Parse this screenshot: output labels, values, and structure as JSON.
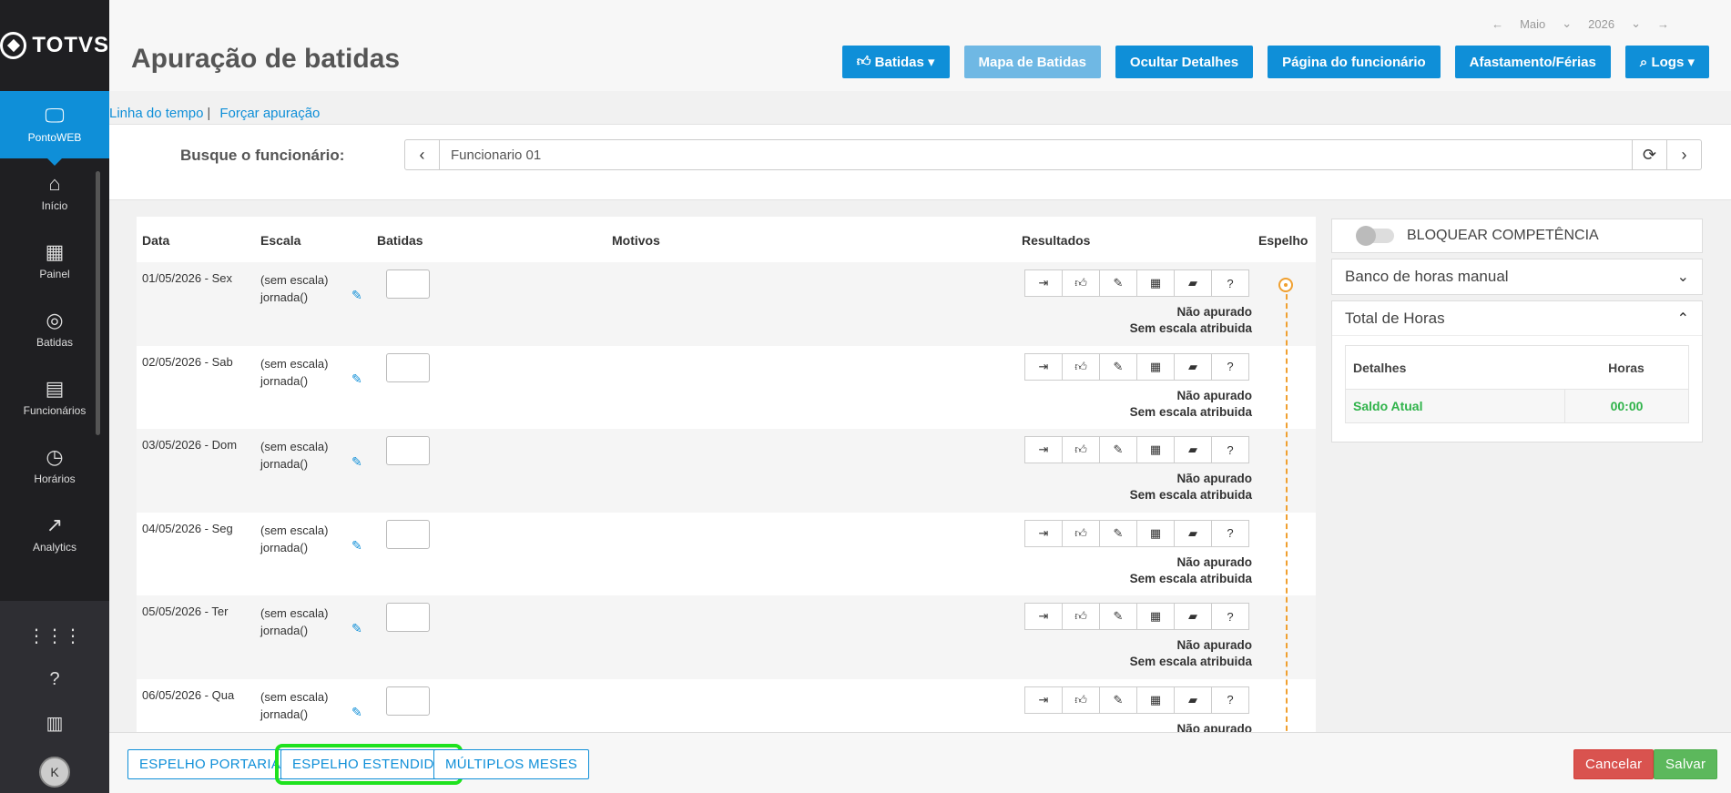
{
  "brand": "TOTVS",
  "nav": [
    {
      "label": "PontoWEB",
      "icon": "monitor-icon"
    },
    {
      "label": "Início",
      "icon": "home-icon"
    },
    {
      "label": "Painel",
      "icon": "dashboard-icon"
    },
    {
      "label": "Batidas",
      "icon": "fingerprint-icon"
    },
    {
      "label": "Funcionários",
      "icon": "badge-icon"
    },
    {
      "label": "Horários",
      "icon": "clock-icon"
    },
    {
      "label": "Analytics",
      "icon": "trend-icon"
    }
  ],
  "month": "Maio",
  "year": "2026",
  "title": "Apuração de batidas",
  "buttons": {
    "batidas": "Batidas",
    "mapa": "Mapa de Batidas",
    "ocultar": "Ocultar Detalhes",
    "pagina": "Página do funcionário",
    "afast": "Afastamento/Férias",
    "logs": "Logs"
  },
  "links": {
    "linha": "Linha do tempo",
    "sep": "|",
    "forcar": "Forçar apuração"
  },
  "search": {
    "label": "Busque o funcionário:",
    "value": "Funcionario 01"
  },
  "table": {
    "headers": {
      "data": "Data",
      "escala": "Escala",
      "batidas": "Batidas",
      "motivos": "Motivos",
      "resultados": "Resultados",
      "espelho": "Espelho"
    },
    "rows": [
      {
        "date": "01/05/2026 - Sex",
        "escala": "(sem escala)",
        "jornada": "jornada()",
        "r1": "Não apurado",
        "r2": "Sem escala atribuida"
      },
      {
        "date": "02/05/2026 - Sab",
        "escala": "(sem escala)",
        "jornada": "jornada()",
        "r1": "Não apurado",
        "r2": "Sem escala atribuida"
      },
      {
        "date": "03/05/2026 - Dom",
        "escala": "(sem escala)",
        "jornada": "jornada()",
        "r1": "Não apurado",
        "r2": "Sem escala atribuida"
      },
      {
        "date": "04/05/2026 - Seg",
        "escala": "(sem escala)",
        "jornada": "jornada()",
        "r1": "Não apurado",
        "r2": "Sem escala atribuida"
      },
      {
        "date": "05/05/2026 - Ter",
        "escala": "(sem escala)",
        "jornada": "jornada()",
        "r1": "Não apurado",
        "r2": "Sem escala atribuida"
      },
      {
        "date": "06/05/2026 - Qua",
        "escala": "(sem escala)",
        "jornada": "jornada()",
        "r1": "Não apurado",
        "r2": ""
      }
    ]
  },
  "right": {
    "bloquear": "BLOQUEAR COMPETÊNCIA",
    "banco": "Banco de horas manual",
    "total": "Total de Horas",
    "detalhes": "Detalhes",
    "horas": "Horas",
    "saldo_label": "Saldo Atual",
    "saldo_value": "00:00"
  },
  "footer": {
    "portaria": "ESPELHO PORTARIA",
    "estendido": "ESPELHO ESTENDIDO",
    "multiplos": "MÚLTIPLOS MESES",
    "cancelar": "Cancelar",
    "salvar": "Salvar"
  },
  "colors": {
    "primary": "#0f8fd8",
    "highlight": "#1ee21e",
    "saldo": "#2fb34a",
    "timeline": "#f0a030"
  }
}
